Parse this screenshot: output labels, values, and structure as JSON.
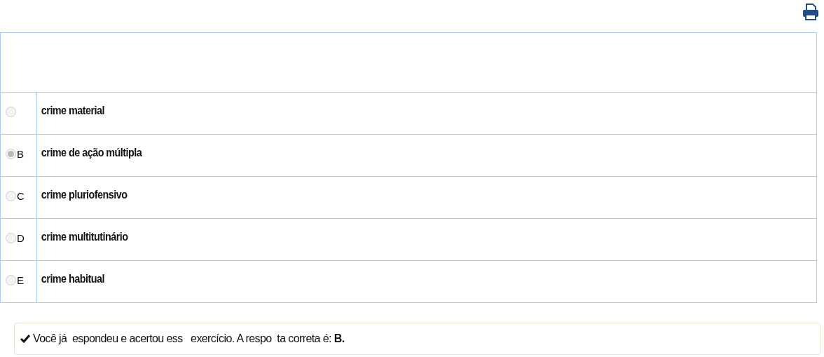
{
  "question": {
    "options": [
      {
        "text": "crime material",
        "selected": false
      },
      {
        "letter": "B",
        "text": "crime de ação múltipla",
        "selected": true
      },
      {
        "letter": "C",
        "text": "crime pluriofensivo",
        "selected": false
      },
      {
        "letter": "D",
        "text": "crime multitutinário",
        "selected": false
      },
      {
        "letter": "E",
        "text": "crime habitual",
        "selected": false
      }
    ]
  },
  "feedback": {
    "text": "Você já  espondeu e acertou ess   exercício. A respo  ta correta é: **B.**"
  }
}
